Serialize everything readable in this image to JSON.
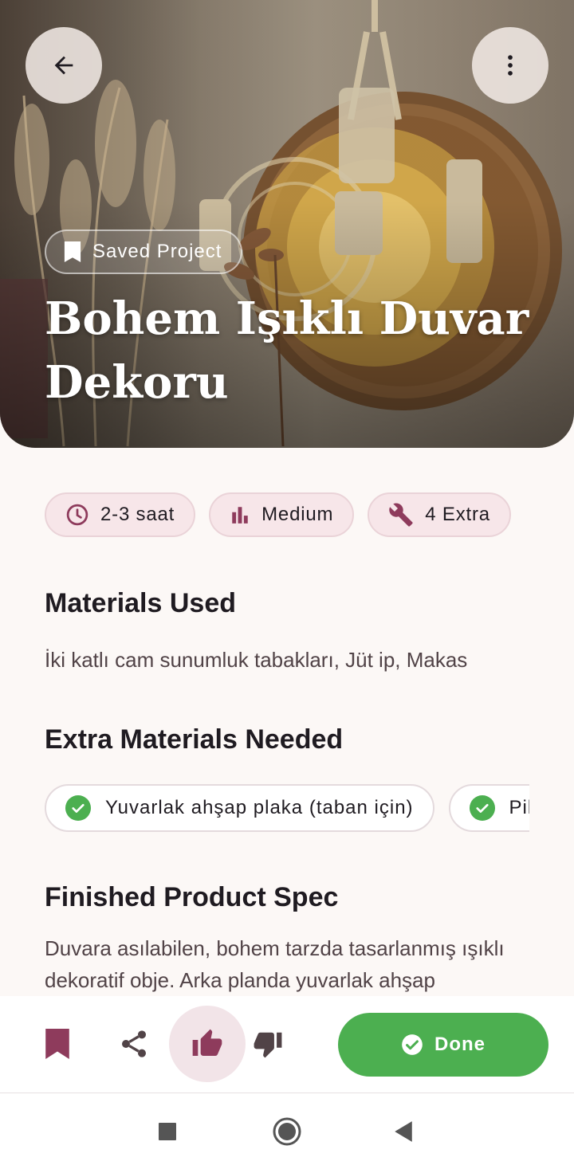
{
  "hero": {
    "badge_label": "Saved Project",
    "title": "Bohem Işıklı Duvar Dekoru",
    "back_icon": "arrow-back-icon",
    "more_icon": "more-vert-icon"
  },
  "meta": [
    {
      "icon": "clock-icon",
      "label": "2-3 saat"
    },
    {
      "icon": "bar-chart-icon",
      "label": "Medium"
    },
    {
      "icon": "wrench-icon",
      "label": "4 Extra"
    }
  ],
  "materials": {
    "title": "Materials Used",
    "text": "İki katlı cam sunumluk tabakları, Jüt ip, Makas"
  },
  "extra": {
    "title": "Extra Materials Needed",
    "items": [
      "Yuvarlak ahşap plaka (taban için)",
      "Pil"
    ]
  },
  "spec": {
    "title": "Finished Product Spec",
    "text": "Duvara asılabilen, bohem tarzda tasarlanmış ışıklı dekoratif obje. Arka planda yuvarlak ahşap"
  },
  "actions": {
    "done_label": "Done"
  },
  "colors": {
    "accent": "#8E3B5C",
    "success": "#4CAF50",
    "chip_bg": "#F7E6E9",
    "background": "#FCF8F6"
  }
}
